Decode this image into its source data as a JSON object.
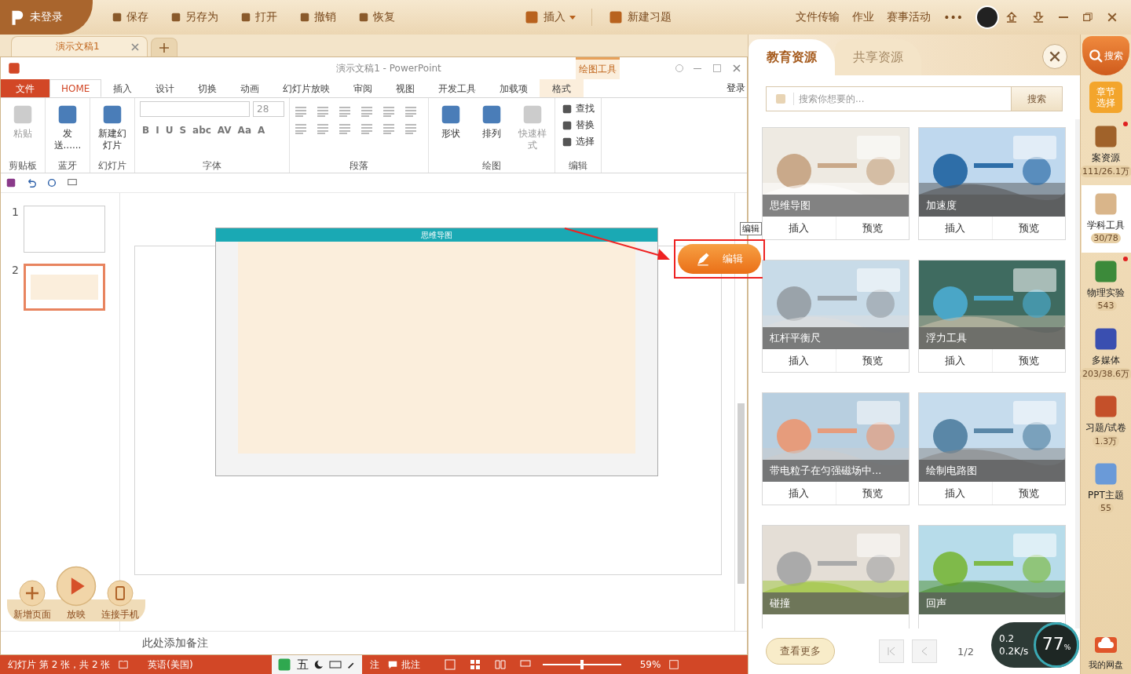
{
  "app_bar": {
    "user": "未登录",
    "actions": [
      "保存",
      "另存为",
      "打开",
      "撤销",
      "恢复"
    ],
    "insert": "插入",
    "new_exercise": "新建习题",
    "links": [
      "文件传输",
      "作业",
      "赛事活动",
      "•••"
    ]
  },
  "doc_tabs": [
    {
      "label": "演示文稿1",
      "selected": true
    }
  ],
  "ppt": {
    "title": "演示文稿1 - PowerPoint",
    "context_title": "绘图工具",
    "login": "登录",
    "tabs": [
      {
        "label": "文件",
        "kind": "file",
        "selected": false
      },
      {
        "label": "HOME",
        "kind": "tab",
        "selected": true
      },
      {
        "label": "插入",
        "kind": "tab",
        "selected": false
      },
      {
        "label": "设计",
        "kind": "tab",
        "selected": false
      },
      {
        "label": "切换",
        "kind": "tab",
        "selected": false
      },
      {
        "label": "动画",
        "kind": "tab",
        "selected": false
      },
      {
        "label": "幻灯片放映",
        "kind": "tab",
        "selected": false
      },
      {
        "label": "审阅",
        "kind": "tab",
        "selected": false
      },
      {
        "label": "视图",
        "kind": "tab",
        "selected": false
      },
      {
        "label": "开发工具",
        "kind": "tab",
        "selected": false
      },
      {
        "label": "加载项",
        "kind": "tab",
        "selected": false
      },
      {
        "label": "格式",
        "kind": "context",
        "selected": false
      }
    ],
    "ribbon_groups": [
      {
        "name": "剪贴板",
        "kind": "buttons",
        "items": [
          {
            "label": "粘贴",
            "disabled": true
          }
        ]
      },
      {
        "name": "蓝牙",
        "kind": "buttons",
        "items": [
          {
            "label": "发送......",
            "disabled": false
          }
        ]
      },
      {
        "name": "幻灯片",
        "kind": "buttons",
        "items": [
          {
            "label": "新建幻灯片",
            "disabled": false
          }
        ]
      },
      {
        "name": "字体",
        "kind": "font",
        "size": "28",
        "glyphs": [
          "B",
          "I",
          "U",
          "S",
          "abc",
          "AV",
          "Aa",
          "A"
        ]
      },
      {
        "name": "段落",
        "kind": "paragraph"
      },
      {
        "name": "绘图",
        "kind": "buttons",
        "items": [
          {
            "label": "形状",
            "disabled": false
          },
          {
            "label": "排列",
            "disabled": false
          },
          {
            "label": "快速样式",
            "disabled": true
          }
        ]
      },
      {
        "name": "编辑",
        "kind": "list",
        "items": [
          {
            "label": "查找",
            "disabled": false
          },
          {
            "label": "替换",
            "disabled": false
          },
          {
            "label": "选择",
            "disabled": false
          }
        ]
      }
    ],
    "slides": [
      {
        "number": "1",
        "selected": false
      },
      {
        "number": "2",
        "selected": true
      }
    ],
    "object_title": "思维导图",
    "edit_button": "编辑",
    "tooltip": "编辑",
    "float_buttons": [
      "新增页面",
      "放映",
      "连接手机"
    ],
    "notes": "此处添加备注"
  },
  "status_bar": {
    "slide_info": "幻灯片 第 2 张，共 2 张",
    "language": "英语(美国)",
    "ime": "五",
    "notes": "注",
    "comments": "批注",
    "zoom": "59%",
    "level": 0.5
  },
  "panel": {
    "tabs": [
      {
        "label": "教育资源",
        "selected": true
      },
      {
        "label": "共享资源",
        "selected": false
      }
    ],
    "search": {
      "placeholder": "搜索你想要的...",
      "button": "搜索"
    },
    "cards": [
      {
        "title": "思维导图",
        "actions": [
          "插入",
          "预览"
        ]
      },
      {
        "title": "加速度",
        "actions": [
          "插入",
          "预览"
        ]
      },
      {
        "title": "杠杆平衡尺",
        "actions": [
          "插入",
          "预览"
        ]
      },
      {
        "title": "浮力工具",
        "actions": [
          "插入",
          "预览"
        ]
      },
      {
        "title": "带电粒子在匀强磁场中...",
        "actions": [
          "插入",
          "预览"
        ]
      },
      {
        "title": "绘制电路图",
        "actions": [
          "插入",
          "预览"
        ]
      },
      {
        "title": "碰撞"
      },
      {
        "title": "回声"
      }
    ],
    "more": "查看更多",
    "page": "1/2"
  },
  "widget": {
    "up": "0.2",
    "down": "0.2K/s",
    "percent": "77",
    "unit": "%"
  },
  "sidebar": {
    "search": "搜索",
    "chapter": "章节选择",
    "items": [
      {
        "label": "案资源",
        "count": "111/26.1万",
        "selected": false,
        "new": true
      },
      {
        "label": "学科工具",
        "count": "30/78",
        "selected": true,
        "new": false
      },
      {
        "label": "物理实验",
        "count": "543",
        "selected": false,
        "new": true
      },
      {
        "label": "多媒体",
        "count": "203/38.6万",
        "selected": false,
        "new": false
      },
      {
        "label": "习题/试卷",
        "count": "1.3万",
        "selected": false,
        "new": false
      },
      {
        "label": "PPT主题",
        "count": "55",
        "selected": false,
        "new": false
      }
    ],
    "disk": "我的网盘"
  }
}
